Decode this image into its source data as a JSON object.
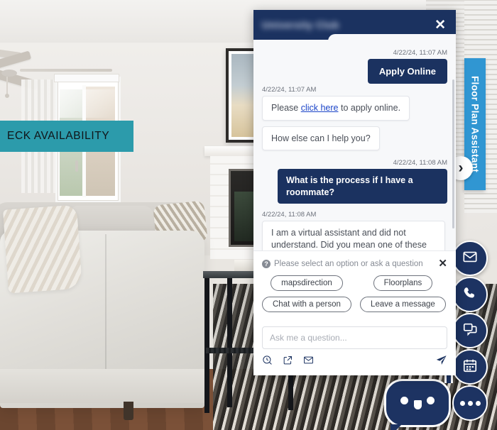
{
  "banner": {
    "label": "ECK AVAILABILITY"
  },
  "floor_plan_tab": {
    "label": "Floor Plan Assistant",
    "chevron": "›"
  },
  "side_buttons": [
    {
      "name": "email",
      "icon": "envelope-icon"
    },
    {
      "name": "phone",
      "icon": "phone-icon"
    },
    {
      "name": "chat",
      "icon": "chat-icon"
    },
    {
      "name": "calendar",
      "icon": "calendar-icon"
    }
  ],
  "bot_launcher": {
    "icon": "robot-face-icon"
  },
  "more_button": {
    "icon": "ellipsis-icon"
  },
  "chat": {
    "header": {
      "title": "University Club",
      "close_label": "✕"
    },
    "messages": [
      {
        "side": "right",
        "timestamp": "4/22/24, 11:07 AM",
        "style": "button",
        "text": "Apply Online"
      },
      {
        "side": "left",
        "timestamp": "4/22/24, 11:07 AM",
        "style": "bot",
        "text_before": "Please ",
        "link": "click here",
        "text_after": " to apply online."
      },
      {
        "side": "left",
        "timestamp": "",
        "style": "bot",
        "text": "How else can I help you?"
      },
      {
        "side": "right",
        "timestamp": "4/22/24, 11:08 AM",
        "style": "user",
        "text": "What is the process if I have a roommate?"
      },
      {
        "side": "left",
        "timestamp": "4/22/24, 11:08 AM",
        "style": "bot",
        "text": "I am a virtual assistant and did not understand. Did you mean one of these options?"
      }
    ],
    "options": {
      "prompt": "Please select an option or ask a question",
      "help_icon": "?",
      "close_label": "✕",
      "chips": [
        "mapsdirection",
        "Floorplans",
        "Chat with a person",
        "Leave a message"
      ]
    },
    "composer": {
      "placeholder": "Ask me a question...",
      "value": "",
      "tools": [
        {
          "name": "history-icon"
        },
        {
          "name": "external-link-icon"
        },
        {
          "name": "envelope-icon"
        }
      ],
      "send": {
        "name": "send-icon"
      }
    }
  },
  "colors": {
    "navy": "#1b3260",
    "teal": "#2c9bab",
    "tab_blue": "#3096d2",
    "link": "#1b44c8"
  }
}
